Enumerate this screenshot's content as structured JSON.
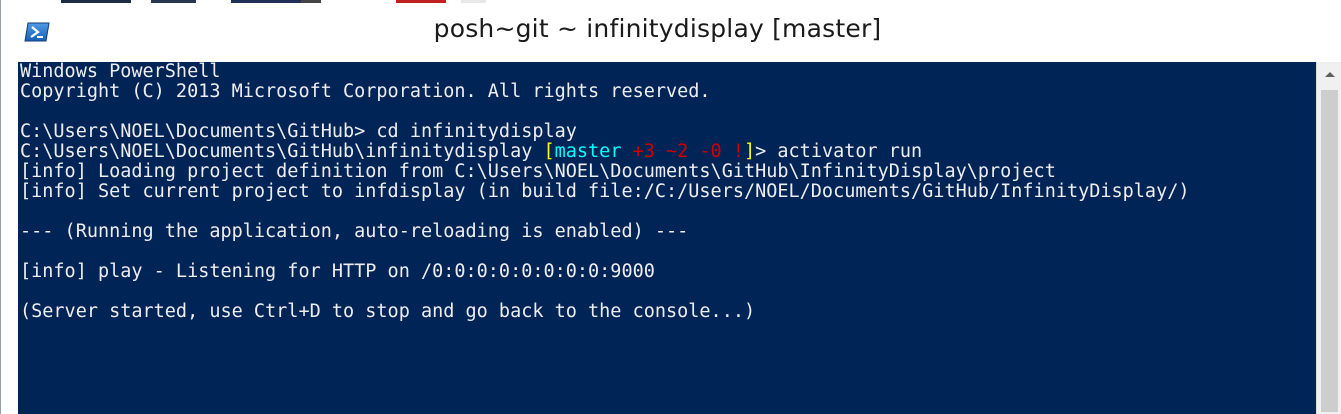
{
  "window": {
    "title": "posh~git ~ infinitydisplay [master]",
    "app_icon": "powershell-icon"
  },
  "colors": {
    "console_background": "#012456",
    "console_text": "#eeedf0",
    "prompt_bracket": "#ffff00",
    "branch_name": "#00ffff",
    "git_status": "#d00000"
  },
  "console": {
    "lines": [
      "Windows PowerShell",
      "Copyright (C) 2013 Microsoft Corporation. All rights reserved.",
      "",
      "C:\\Users\\NOEL\\Documents\\GitHub> cd infinitydisplay",
      "",
      "[info] Loading project definition from C:\\Users\\NOEL\\Documents\\GitHub\\InfinityDisplay\\project",
      "[info] Set current project to infdisplay (in build file:/C:/Users/NOEL/Documents/GitHub/InfinityDisplay/)",
      "",
      "--- (Running the application, auto-reloading is enabled) ---",
      "",
      "[info] play - Listening for HTTP on /0:0:0:0:0:0:0:0:9000",
      "",
      "(Server started, use Ctrl+D to stop and go back to the console...)"
    ],
    "prompt_line": {
      "path": "C:\\Users\\NOEL\\Documents\\GitHub\\infinitydisplay ",
      "bracket_open": "[",
      "branch": "master",
      "status": " +3 ~2 -0 !",
      "bracket_close": "]",
      "command": "> activator run"
    }
  }
}
